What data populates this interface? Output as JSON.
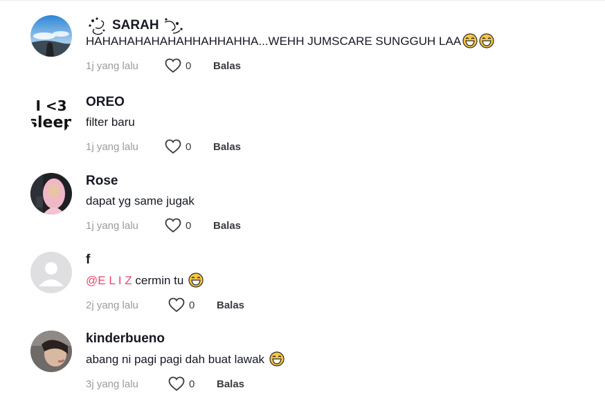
{
  "comments": [
    {
      "username": "SARAH",
      "text": "HAHAHAHAHAHAHHAHHAHHA...WEHH JUMSCARE SUNGGUH LAA",
      "emoji_count": 2,
      "time": "1j yang lalu",
      "likes": "0",
      "reply_label": "Balas",
      "avatar": "landscape-avatar"
    },
    {
      "username": "OREO",
      "text": "filter baru",
      "time": "1j yang lalu",
      "likes": "0",
      "reply_label": "Balas",
      "avatar": "i-heart-sleep-avatar",
      "avatar_text_top": "I <3",
      "avatar_text_bottom": "sleep"
    },
    {
      "username": "Rose",
      "text": "dapat yg same jugak",
      "time": "1j yang lalu",
      "likes": "0",
      "reply_label": "Balas",
      "avatar": "photo-avatar"
    },
    {
      "username": "f",
      "mention": "@E L I Z",
      "text": " cermin tu",
      "emoji_count": 1,
      "time": "2j yang lalu",
      "likes": "0",
      "reply_label": "Balas",
      "avatar": "default-avatar"
    },
    {
      "username": "kinderbueno",
      "text": "abang ni pagi pagi dah buat lawak",
      "emoji_count": 1,
      "time": "3j yang lalu",
      "likes": "0",
      "reply_label": "Balas",
      "avatar": "photo-avatar"
    }
  ],
  "icons": {
    "like": "heart-outline-icon",
    "emoji": "laughing-face-emoji"
  },
  "colors": {
    "mention": "#e3466b",
    "time": "#9b9b9f",
    "text": "#161823"
  }
}
